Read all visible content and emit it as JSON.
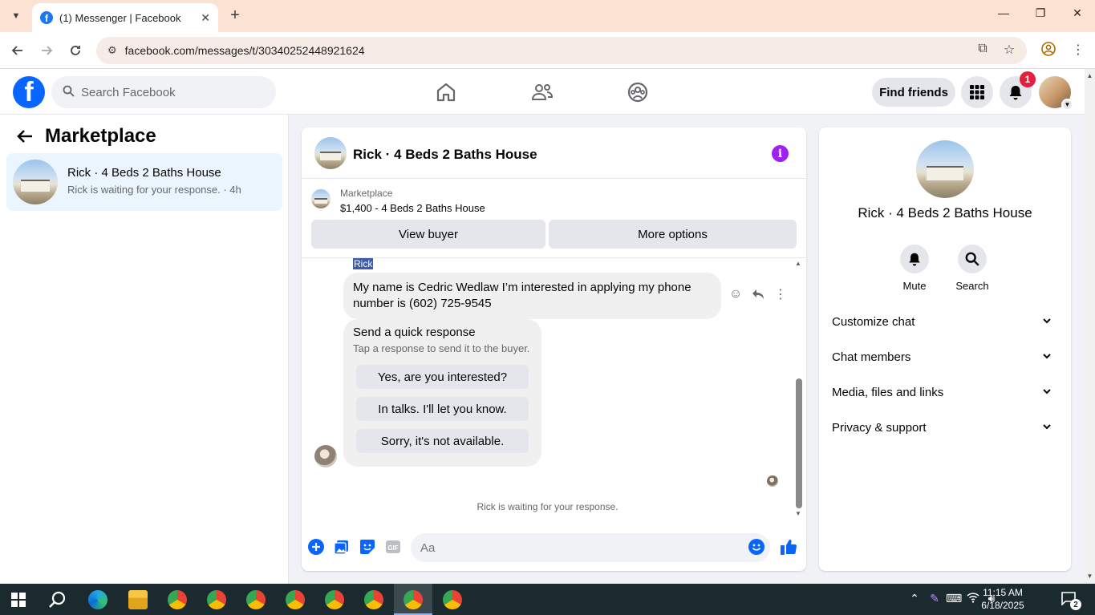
{
  "browser": {
    "tab_title": "(1) Messenger | Facebook",
    "url": "facebook.com/messages/t/30340252448921624",
    "icons": [
      "tab-list-icon",
      "close-tab-icon",
      "new-tab-icon",
      "minimize-icon",
      "maximize-icon",
      "close-window-icon",
      "back-icon",
      "forward-icon",
      "reload-icon",
      "site-info-icon",
      "install-icon",
      "bookmark-star-icon",
      "profile-icon",
      "menu-icon"
    ]
  },
  "fb_header": {
    "search_placeholder": "Search Facebook",
    "find_friends": "Find friends",
    "notification_count": "1",
    "nav_icons": [
      "home-icon",
      "friends-icon",
      "groups-icon"
    ]
  },
  "left_panel": {
    "title": "Marketplace",
    "conversations": [
      {
        "name": "Rick · 4 Beds 2 Baths House",
        "preview": "Rick is waiting for your response. · 4h"
      }
    ]
  },
  "chat": {
    "header_name": "Rick · 4 Beds 2 Baths House",
    "marketplace_label": "Marketplace",
    "listing": "$1,400 - 4 Beds 2 Baths House",
    "view_buyer": "View buyer",
    "more_options": "More options",
    "sender_label": "Rick",
    "message": "My name is Cedric Wedlaw I’m interested in applying my phone number is (602) 725-9545",
    "quick_response": {
      "title": "Send a quick response",
      "subtitle": "Tap a response to send it to the buyer.",
      "options": [
        "Yes, are you interested?",
        "In talks. I'll let you know.",
        "Sorry, it's not available."
      ]
    },
    "status": "Rick is waiting for your response.",
    "composer_placeholder": "Aa",
    "accent_color": "#0866ff",
    "info_color": "#a020f0"
  },
  "right_panel": {
    "name": "Rick · 4 Beds 2 Baths House",
    "actions": [
      {
        "label": "Mute",
        "icon": "bell-icon"
      },
      {
        "label": "Search",
        "icon": "search-icon"
      }
    ],
    "sections": [
      "Customize chat",
      "Chat members",
      "Media, files and links",
      "Privacy & support"
    ]
  },
  "taskbar": {
    "time": "11:15 AM",
    "date": "6/18/2025",
    "notifications": "2"
  }
}
